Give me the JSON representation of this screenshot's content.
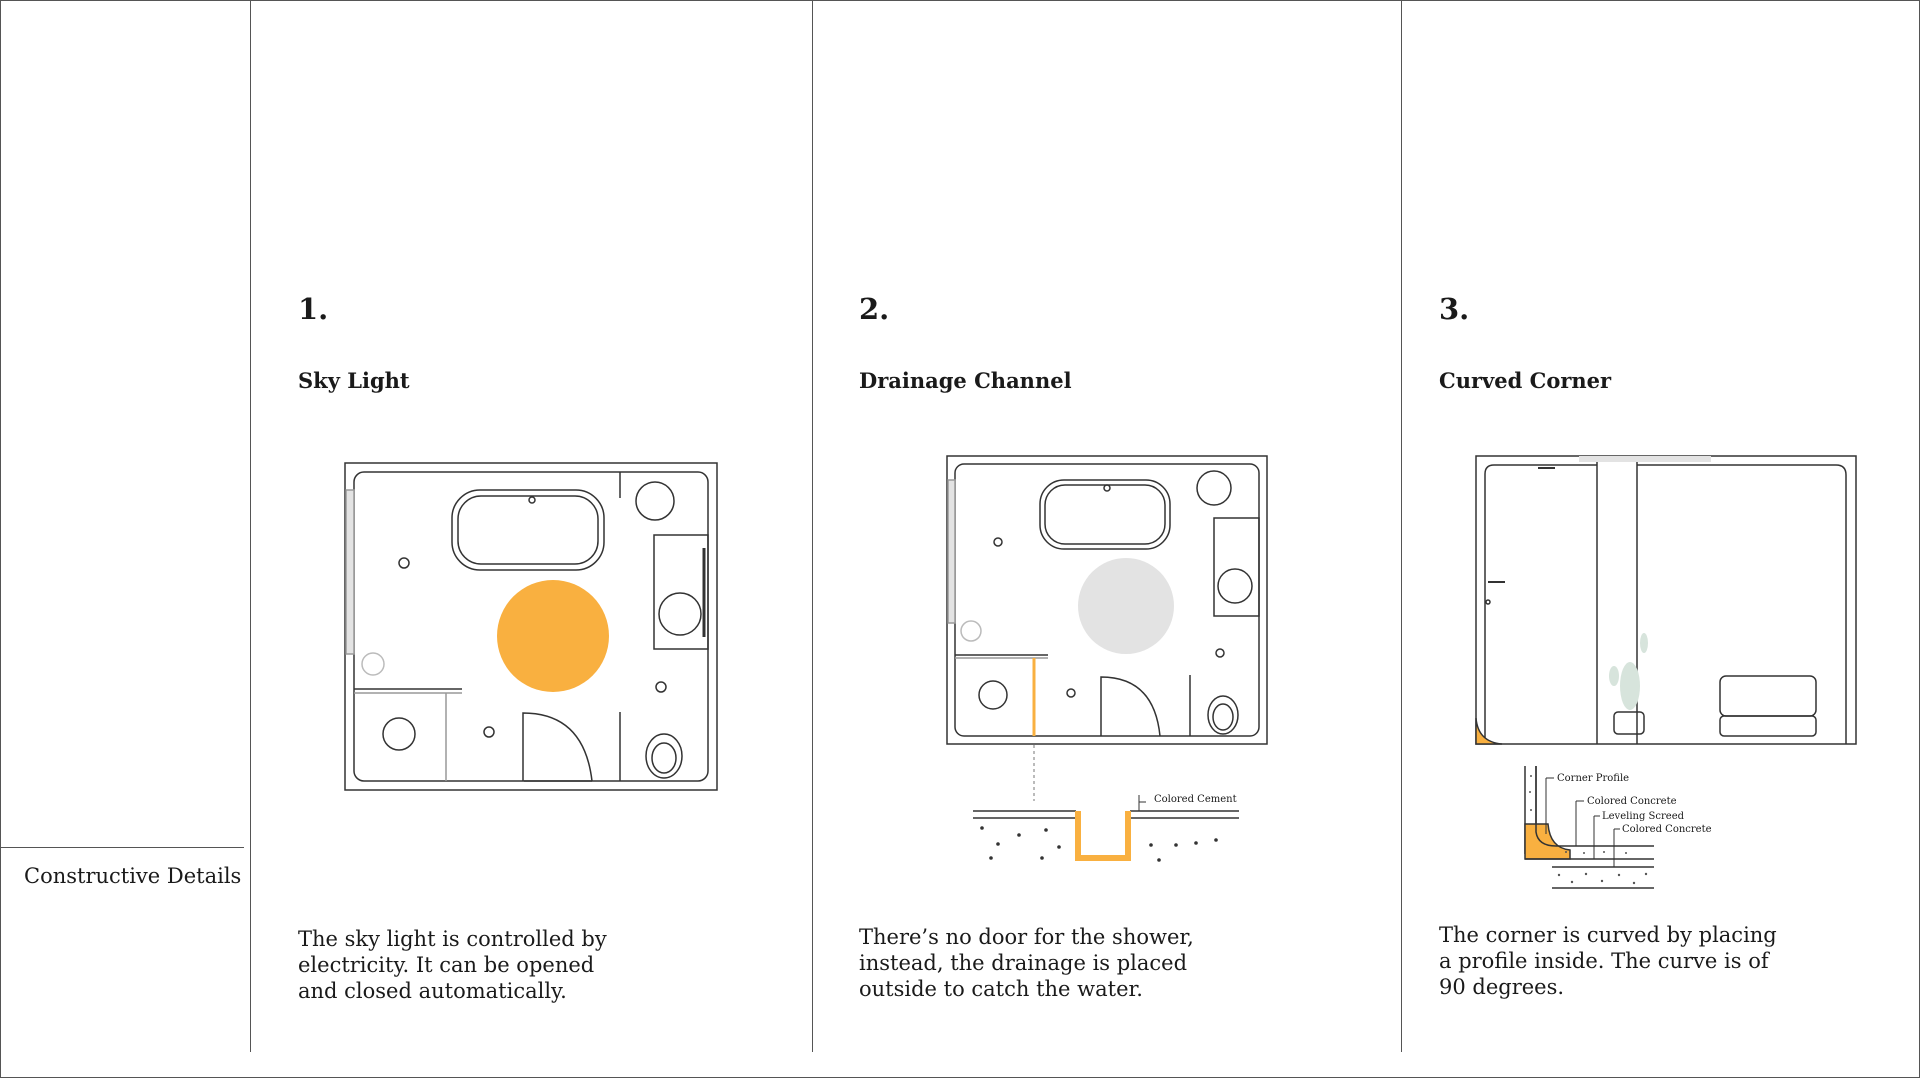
{
  "sidebar": {
    "section_label": "Constructive Details"
  },
  "colors": {
    "accent_orange": "#f9b040",
    "light_grey": "#e3e3e3",
    "line": "#333333"
  },
  "details": [
    {
      "number": "1.",
      "title": "Sky Light",
      "description_lines": [
        "The sky light is controlled by",
        "electricity. It can be opened",
        "and closed automatically."
      ]
    },
    {
      "number": "2.",
      "title": "Drainage Channel",
      "description_lines": [
        "There’s no door for the shower,",
        "instead, the drainage is placed",
        "outside to catch the water."
      ],
      "callouts": [
        "Colored Cement"
      ]
    },
    {
      "number": "3.",
      "title": "Curved Corner",
      "description_lines": [
        "The corner is curved by placing",
        "a profile inside. The curve is of",
        "90 degrees."
      ],
      "callouts": [
        "Corner Profile",
        "Colored Concrete",
        "Leveling Screed",
        "Colored Concrete"
      ]
    }
  ]
}
